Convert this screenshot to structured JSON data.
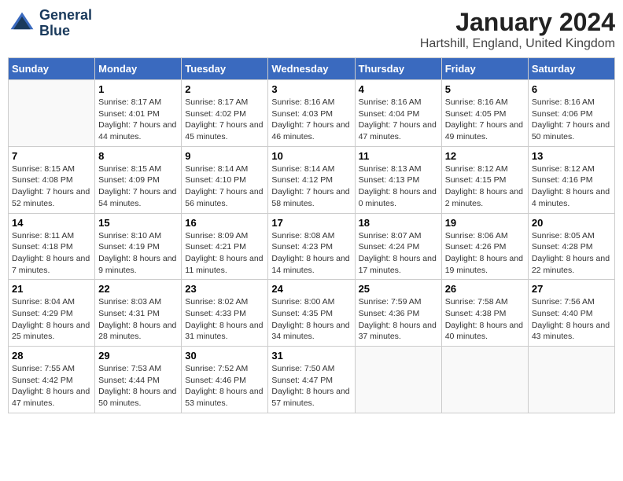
{
  "header": {
    "logo_line1": "General",
    "logo_line2": "Blue",
    "month_year": "January 2024",
    "location": "Hartshill, England, United Kingdom"
  },
  "days_of_week": [
    "Sunday",
    "Monday",
    "Tuesday",
    "Wednesday",
    "Thursday",
    "Friday",
    "Saturday"
  ],
  "weeks": [
    [
      {
        "day": "",
        "sunrise": "",
        "sunset": "",
        "daylight": ""
      },
      {
        "day": "1",
        "sunrise": "Sunrise: 8:17 AM",
        "sunset": "Sunset: 4:01 PM",
        "daylight": "Daylight: 7 hours and 44 minutes."
      },
      {
        "day": "2",
        "sunrise": "Sunrise: 8:17 AM",
        "sunset": "Sunset: 4:02 PM",
        "daylight": "Daylight: 7 hours and 45 minutes."
      },
      {
        "day": "3",
        "sunrise": "Sunrise: 8:16 AM",
        "sunset": "Sunset: 4:03 PM",
        "daylight": "Daylight: 7 hours and 46 minutes."
      },
      {
        "day": "4",
        "sunrise": "Sunrise: 8:16 AM",
        "sunset": "Sunset: 4:04 PM",
        "daylight": "Daylight: 7 hours and 47 minutes."
      },
      {
        "day": "5",
        "sunrise": "Sunrise: 8:16 AM",
        "sunset": "Sunset: 4:05 PM",
        "daylight": "Daylight: 7 hours and 49 minutes."
      },
      {
        "day": "6",
        "sunrise": "Sunrise: 8:16 AM",
        "sunset": "Sunset: 4:06 PM",
        "daylight": "Daylight: 7 hours and 50 minutes."
      }
    ],
    [
      {
        "day": "7",
        "sunrise": "Sunrise: 8:15 AM",
        "sunset": "Sunset: 4:08 PM",
        "daylight": "Daylight: 7 hours and 52 minutes."
      },
      {
        "day": "8",
        "sunrise": "Sunrise: 8:15 AM",
        "sunset": "Sunset: 4:09 PM",
        "daylight": "Daylight: 7 hours and 54 minutes."
      },
      {
        "day": "9",
        "sunrise": "Sunrise: 8:14 AM",
        "sunset": "Sunset: 4:10 PM",
        "daylight": "Daylight: 7 hours and 56 minutes."
      },
      {
        "day": "10",
        "sunrise": "Sunrise: 8:14 AM",
        "sunset": "Sunset: 4:12 PM",
        "daylight": "Daylight: 7 hours and 58 minutes."
      },
      {
        "day": "11",
        "sunrise": "Sunrise: 8:13 AM",
        "sunset": "Sunset: 4:13 PM",
        "daylight": "Daylight: 8 hours and 0 minutes."
      },
      {
        "day": "12",
        "sunrise": "Sunrise: 8:12 AM",
        "sunset": "Sunset: 4:15 PM",
        "daylight": "Daylight: 8 hours and 2 minutes."
      },
      {
        "day": "13",
        "sunrise": "Sunrise: 8:12 AM",
        "sunset": "Sunset: 4:16 PM",
        "daylight": "Daylight: 8 hours and 4 minutes."
      }
    ],
    [
      {
        "day": "14",
        "sunrise": "Sunrise: 8:11 AM",
        "sunset": "Sunset: 4:18 PM",
        "daylight": "Daylight: 8 hours and 7 minutes."
      },
      {
        "day": "15",
        "sunrise": "Sunrise: 8:10 AM",
        "sunset": "Sunset: 4:19 PM",
        "daylight": "Daylight: 8 hours and 9 minutes."
      },
      {
        "day": "16",
        "sunrise": "Sunrise: 8:09 AM",
        "sunset": "Sunset: 4:21 PM",
        "daylight": "Daylight: 8 hours and 11 minutes."
      },
      {
        "day": "17",
        "sunrise": "Sunrise: 8:08 AM",
        "sunset": "Sunset: 4:23 PM",
        "daylight": "Daylight: 8 hours and 14 minutes."
      },
      {
        "day": "18",
        "sunrise": "Sunrise: 8:07 AM",
        "sunset": "Sunset: 4:24 PM",
        "daylight": "Daylight: 8 hours and 17 minutes."
      },
      {
        "day": "19",
        "sunrise": "Sunrise: 8:06 AM",
        "sunset": "Sunset: 4:26 PM",
        "daylight": "Daylight: 8 hours and 19 minutes."
      },
      {
        "day": "20",
        "sunrise": "Sunrise: 8:05 AM",
        "sunset": "Sunset: 4:28 PM",
        "daylight": "Daylight: 8 hours and 22 minutes."
      }
    ],
    [
      {
        "day": "21",
        "sunrise": "Sunrise: 8:04 AM",
        "sunset": "Sunset: 4:29 PM",
        "daylight": "Daylight: 8 hours and 25 minutes."
      },
      {
        "day": "22",
        "sunrise": "Sunrise: 8:03 AM",
        "sunset": "Sunset: 4:31 PM",
        "daylight": "Daylight: 8 hours and 28 minutes."
      },
      {
        "day": "23",
        "sunrise": "Sunrise: 8:02 AM",
        "sunset": "Sunset: 4:33 PM",
        "daylight": "Daylight: 8 hours and 31 minutes."
      },
      {
        "day": "24",
        "sunrise": "Sunrise: 8:00 AM",
        "sunset": "Sunset: 4:35 PM",
        "daylight": "Daylight: 8 hours and 34 minutes."
      },
      {
        "day": "25",
        "sunrise": "Sunrise: 7:59 AM",
        "sunset": "Sunset: 4:36 PM",
        "daylight": "Daylight: 8 hours and 37 minutes."
      },
      {
        "day": "26",
        "sunrise": "Sunrise: 7:58 AM",
        "sunset": "Sunset: 4:38 PM",
        "daylight": "Daylight: 8 hours and 40 minutes."
      },
      {
        "day": "27",
        "sunrise": "Sunrise: 7:56 AM",
        "sunset": "Sunset: 4:40 PM",
        "daylight": "Daylight: 8 hours and 43 minutes."
      }
    ],
    [
      {
        "day": "28",
        "sunrise": "Sunrise: 7:55 AM",
        "sunset": "Sunset: 4:42 PM",
        "daylight": "Daylight: 8 hours and 47 minutes."
      },
      {
        "day": "29",
        "sunrise": "Sunrise: 7:53 AM",
        "sunset": "Sunset: 4:44 PM",
        "daylight": "Daylight: 8 hours and 50 minutes."
      },
      {
        "day": "30",
        "sunrise": "Sunrise: 7:52 AM",
        "sunset": "Sunset: 4:46 PM",
        "daylight": "Daylight: 8 hours and 53 minutes."
      },
      {
        "day": "31",
        "sunrise": "Sunrise: 7:50 AM",
        "sunset": "Sunset: 4:47 PM",
        "daylight": "Daylight: 8 hours and 57 minutes."
      },
      {
        "day": "",
        "sunrise": "",
        "sunset": "",
        "daylight": ""
      },
      {
        "day": "",
        "sunrise": "",
        "sunset": "",
        "daylight": ""
      },
      {
        "day": "",
        "sunrise": "",
        "sunset": "",
        "daylight": ""
      }
    ]
  ]
}
